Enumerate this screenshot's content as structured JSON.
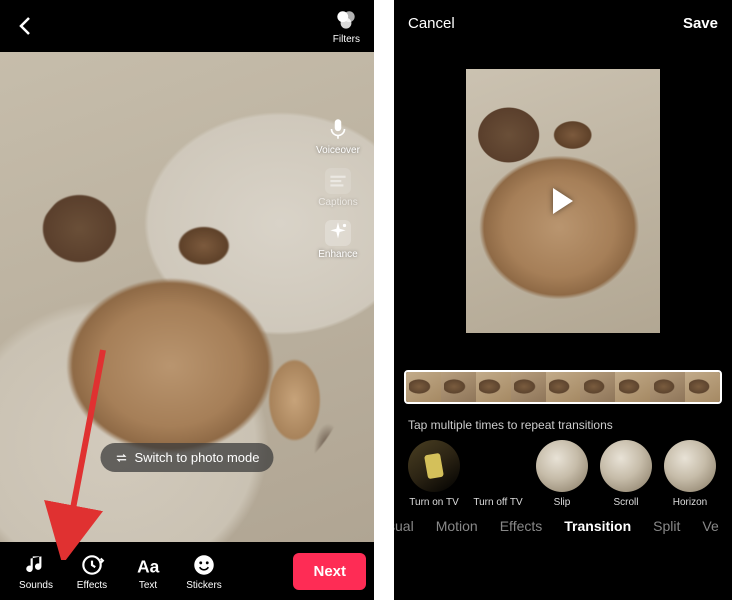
{
  "left": {
    "filters_label": "Filters",
    "side_tools": {
      "voiceover": "Voiceover",
      "captions": "Captions",
      "enhance": "Enhance"
    },
    "switch_label": "Switch to photo mode",
    "bottom_tools": {
      "sounds": "Sounds",
      "effects": "Effects",
      "text": "Text",
      "stickers": "Stickers"
    },
    "next_label": "Next"
  },
  "right": {
    "cancel": "Cancel",
    "save": "Save",
    "hint": "Tap multiple times to repeat transitions",
    "transitions": {
      "turn_on": "Turn on TV",
      "turn_off": "Turn off TV",
      "slip": "Slip",
      "scroll": "Scroll",
      "horizon": "Horizon"
    },
    "tabs": {
      "visual": "sual",
      "motion": "Motion",
      "effects": "Effects",
      "transition": "Transition",
      "split": "Split",
      "vertical": "Ve"
    }
  }
}
